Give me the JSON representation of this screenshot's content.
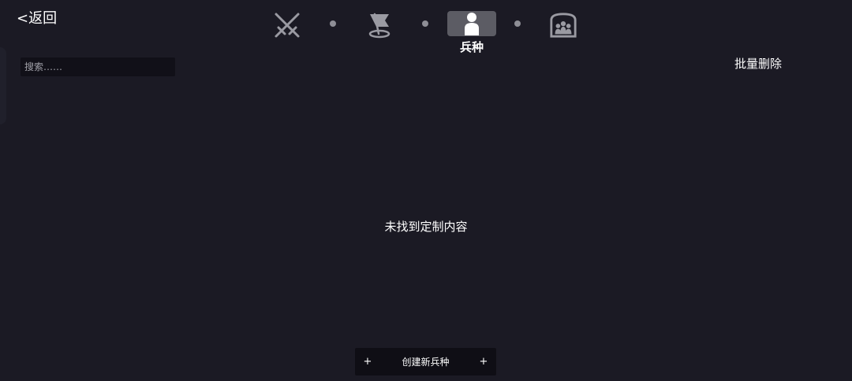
{
  "header": {
    "back_label": "<返回",
    "tabs": [
      {
        "icon": "crossed-swords-icon",
        "label": ""
      },
      {
        "icon": "flag-icon",
        "label": ""
      },
      {
        "icon": "person-icon",
        "label": "兵种",
        "active": true
      },
      {
        "icon": "castle-group-icon",
        "label": ""
      }
    ],
    "batch_delete_label": "批量删除"
  },
  "search": {
    "placeholder": "搜索……"
  },
  "main": {
    "empty_message": "未找到定制内容"
  },
  "footer": {
    "create_plus_left": "+",
    "create_label": "创建新兵种",
    "create_plus_right": "+"
  },
  "colors": {
    "background": "#1b1a24",
    "active_tab": "#5c5c64",
    "icon_gray": "#9a9aa2",
    "search_bg": "#111018",
    "button_bg": "#0f0e15"
  }
}
